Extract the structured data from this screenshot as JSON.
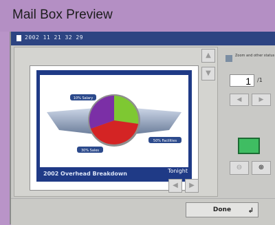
{
  "window": {
    "title": "Mail Box Preview"
  },
  "header": {
    "doc_name": "2002 11 21 32 29"
  },
  "preview": {
    "slide_title": "2002 Overhead Breakdown",
    "logo_text": "Tonight",
    "labels": [
      "10% Salary",
      "50% Facilities",
      "30% Sales"
    ],
    "slice_colors": [
      "#7b2fa6",
      "#7ec832",
      "#d42424"
    ]
  },
  "pager": {
    "current_page": "1",
    "total": "/1"
  },
  "controls": {
    "tiny_caption": "Zoom and other status",
    "done_label": "Done"
  },
  "icons": {
    "doc": "document-icon",
    "scroll_up": "scroll-up-icon",
    "scroll_down": "scroll-down-icon",
    "prev": "chevron-left-icon",
    "next": "chevron-right-icon",
    "zoom_out": "zoom-out-icon",
    "zoom_in": "zoom-in-icon",
    "enter": "enter-icon"
  }
}
